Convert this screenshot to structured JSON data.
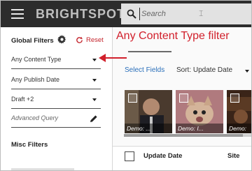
{
  "header": {
    "logo_text": "BRIGHTSPOT",
    "search_placeholder": "Search"
  },
  "sidebar": {
    "global_filters_title": "Global Filters",
    "reset_label": "Reset",
    "filters": [
      {
        "label": "Any Content Type"
      },
      {
        "label": "Any Publish Date"
      },
      {
        "label": "Draft +2"
      }
    ],
    "advanced_query_label": "Advanced Query",
    "misc_filters_title": "Misc Filters"
  },
  "main": {
    "select_fields_label": "Select Fields",
    "sort_label": "Sort: Update Date",
    "thumbnails": [
      {
        "caption": "Demo: ..."
      },
      {
        "caption": "Demo: I..."
      },
      {
        "caption": "Demo:"
      }
    ],
    "columns": {
      "update_date": "Update Date",
      "site": "Site"
    }
  },
  "annotation": {
    "text": "Any Content Type filter",
    "color": "#d11f2b"
  },
  "colors": {
    "header_bg": "#2c2c2c",
    "accent_link": "#2a6fba",
    "reset_red": "#c4242c"
  }
}
